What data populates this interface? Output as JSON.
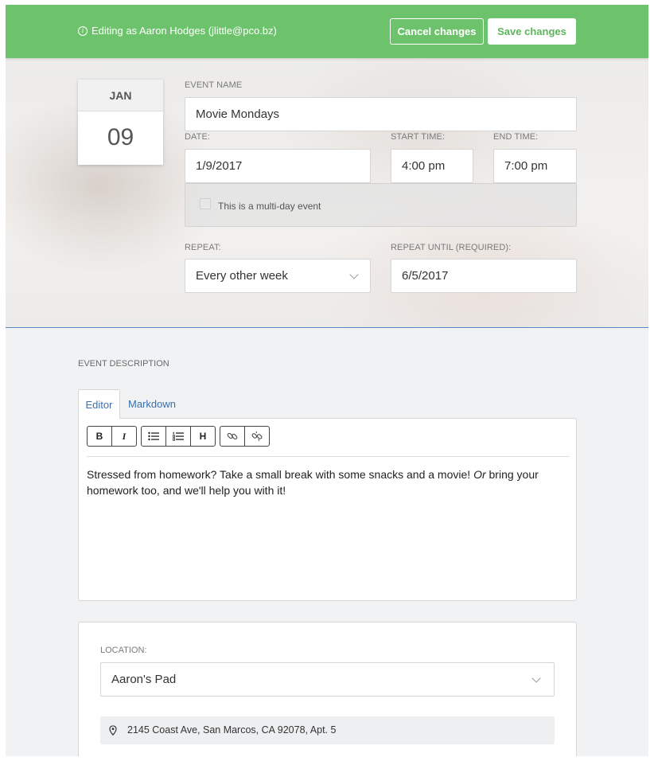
{
  "header": {
    "editing_text": "Editing as Aaron Hodges (jlittle@pco.bz)",
    "cancel_label": "Cancel changes",
    "save_label": "Save changes"
  },
  "date_card": {
    "month": "JAN",
    "day": "09"
  },
  "event": {
    "name_label": "EVENT NAME",
    "name_value": "Movie Mondays",
    "date_label": "DATE:",
    "date_value": "1/9/2017",
    "start_label": "START TIME:",
    "start_value": "4:00 pm",
    "end_label": "END TIME:",
    "end_value": "7:00 pm",
    "multiday_label": "This is a multi-day event",
    "repeat_label": "REPEAT:",
    "repeat_value": "Every other week",
    "repeat_until_label": "REPEAT UNTIL (REQUIRED):",
    "repeat_until_value": "6/5/2017"
  },
  "description": {
    "title": "EVENT DESCRIPTION",
    "tabs": [
      "Editor",
      "Markdown"
    ],
    "toolbar": {
      "bold": "B",
      "italic": "I",
      "heading": "H"
    },
    "text_before": "Stressed from homework? Take a small break with some snacks and a movie! ",
    "text_italic": "Or",
    "text_after": " bring your homework too, and we'll help you with it!"
  },
  "location": {
    "label": "LOCATION:",
    "value": "Aaron's Pad",
    "address": "2145 Coast Ave, San Marcos, CA 92078, Apt. 5"
  },
  "colors": {
    "header_green": "#6dc36b",
    "save_text_green": "#5db55c",
    "link_blue": "#3a6fb0"
  },
  "icons": [
    "info-icon",
    "chevron-down-icon",
    "bullet-list-icon",
    "numbered-list-icon",
    "link-icon",
    "unlink-icon",
    "map-pin-icon"
  ]
}
